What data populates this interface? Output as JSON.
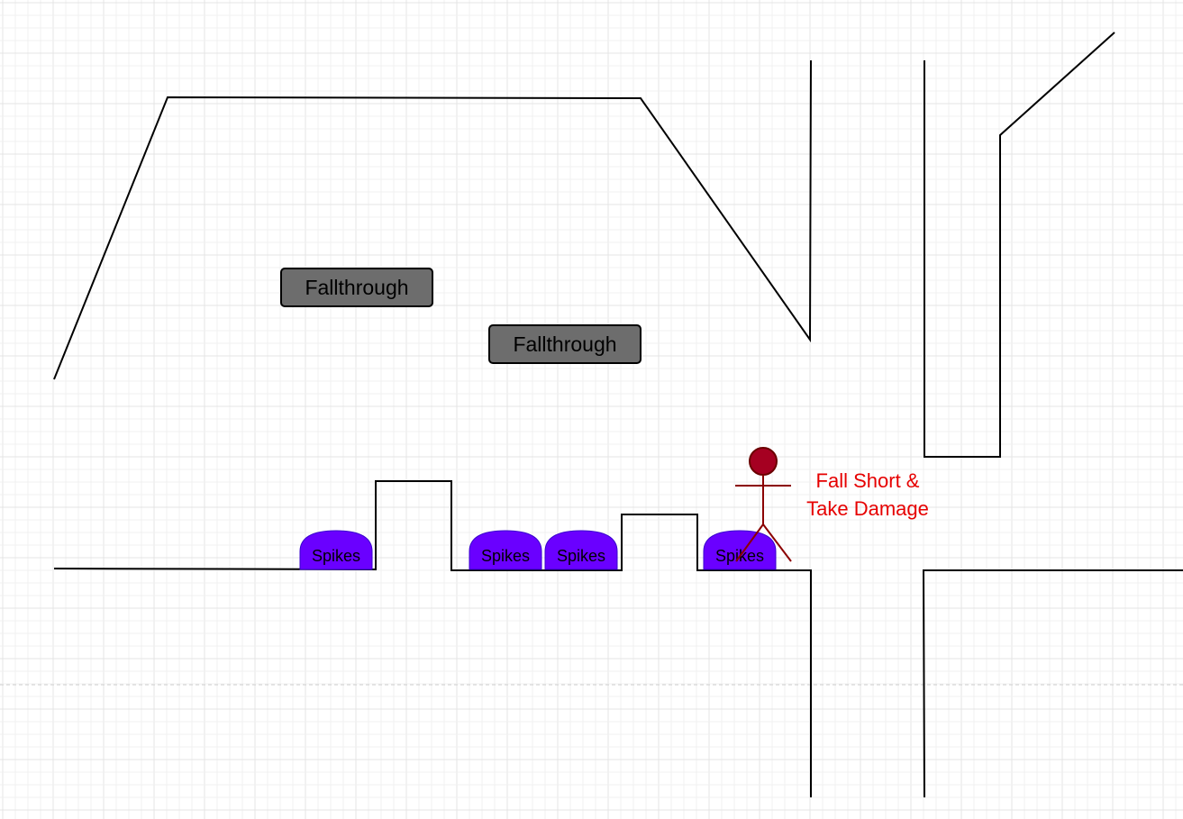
{
  "platforms": [
    {
      "label": "Fallthrough"
    },
    {
      "label": "Fallthrough"
    }
  ],
  "spikes": [
    {
      "label": "Spikes"
    },
    {
      "label": "Spikes"
    },
    {
      "label": "Spikes"
    },
    {
      "label": "Spikes"
    }
  ],
  "annotation": {
    "line1": "Fall Short &",
    "line2": "Take Damage",
    "color": "#e60000"
  },
  "colors": {
    "spike_fill": "#6a00ff",
    "platform_fill": "#6d6d6d",
    "character": "#a50021"
  }
}
